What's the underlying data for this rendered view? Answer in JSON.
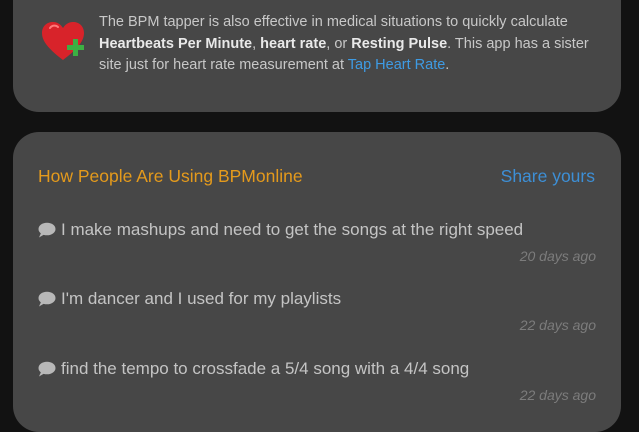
{
  "info": {
    "text_intro": "The BPM tapper is also effective in medical situations to quickly calculate ",
    "bold_1": "Heartbeats Per Minute",
    "sep_1": ", ",
    "bold_2": "heart rate",
    "sep_2": ", or ",
    "bold_3": "Resting Pulse",
    "text_mid": ". This app has a sister site just for heart rate measurement at ",
    "link_label": "Tap Heart Rate",
    "text_end": "."
  },
  "usage": {
    "title": "How People Are Using BPMonline",
    "share_label": "Share yours",
    "comments": [
      {
        "text": "I make mashups and need to get the songs at the right speed",
        "date": "20 days ago"
      },
      {
        "text": "I'm dancer and I used for my playlists",
        "date": "22 days ago"
      },
      {
        "text": "find the tempo to crossfade a 5/4 song with a 4/4 song",
        "date": "22 days ago"
      }
    ]
  },
  "icons": {
    "heart": "heart-plus-icon",
    "comment": "speech-bubble-icon"
  },
  "colors": {
    "background": "#121212",
    "card": "#474747",
    "title_orange": "#e49a1c",
    "link_blue": "#3e9be4",
    "heart_red": "#d8232a",
    "plus_green": "#3cb043"
  }
}
